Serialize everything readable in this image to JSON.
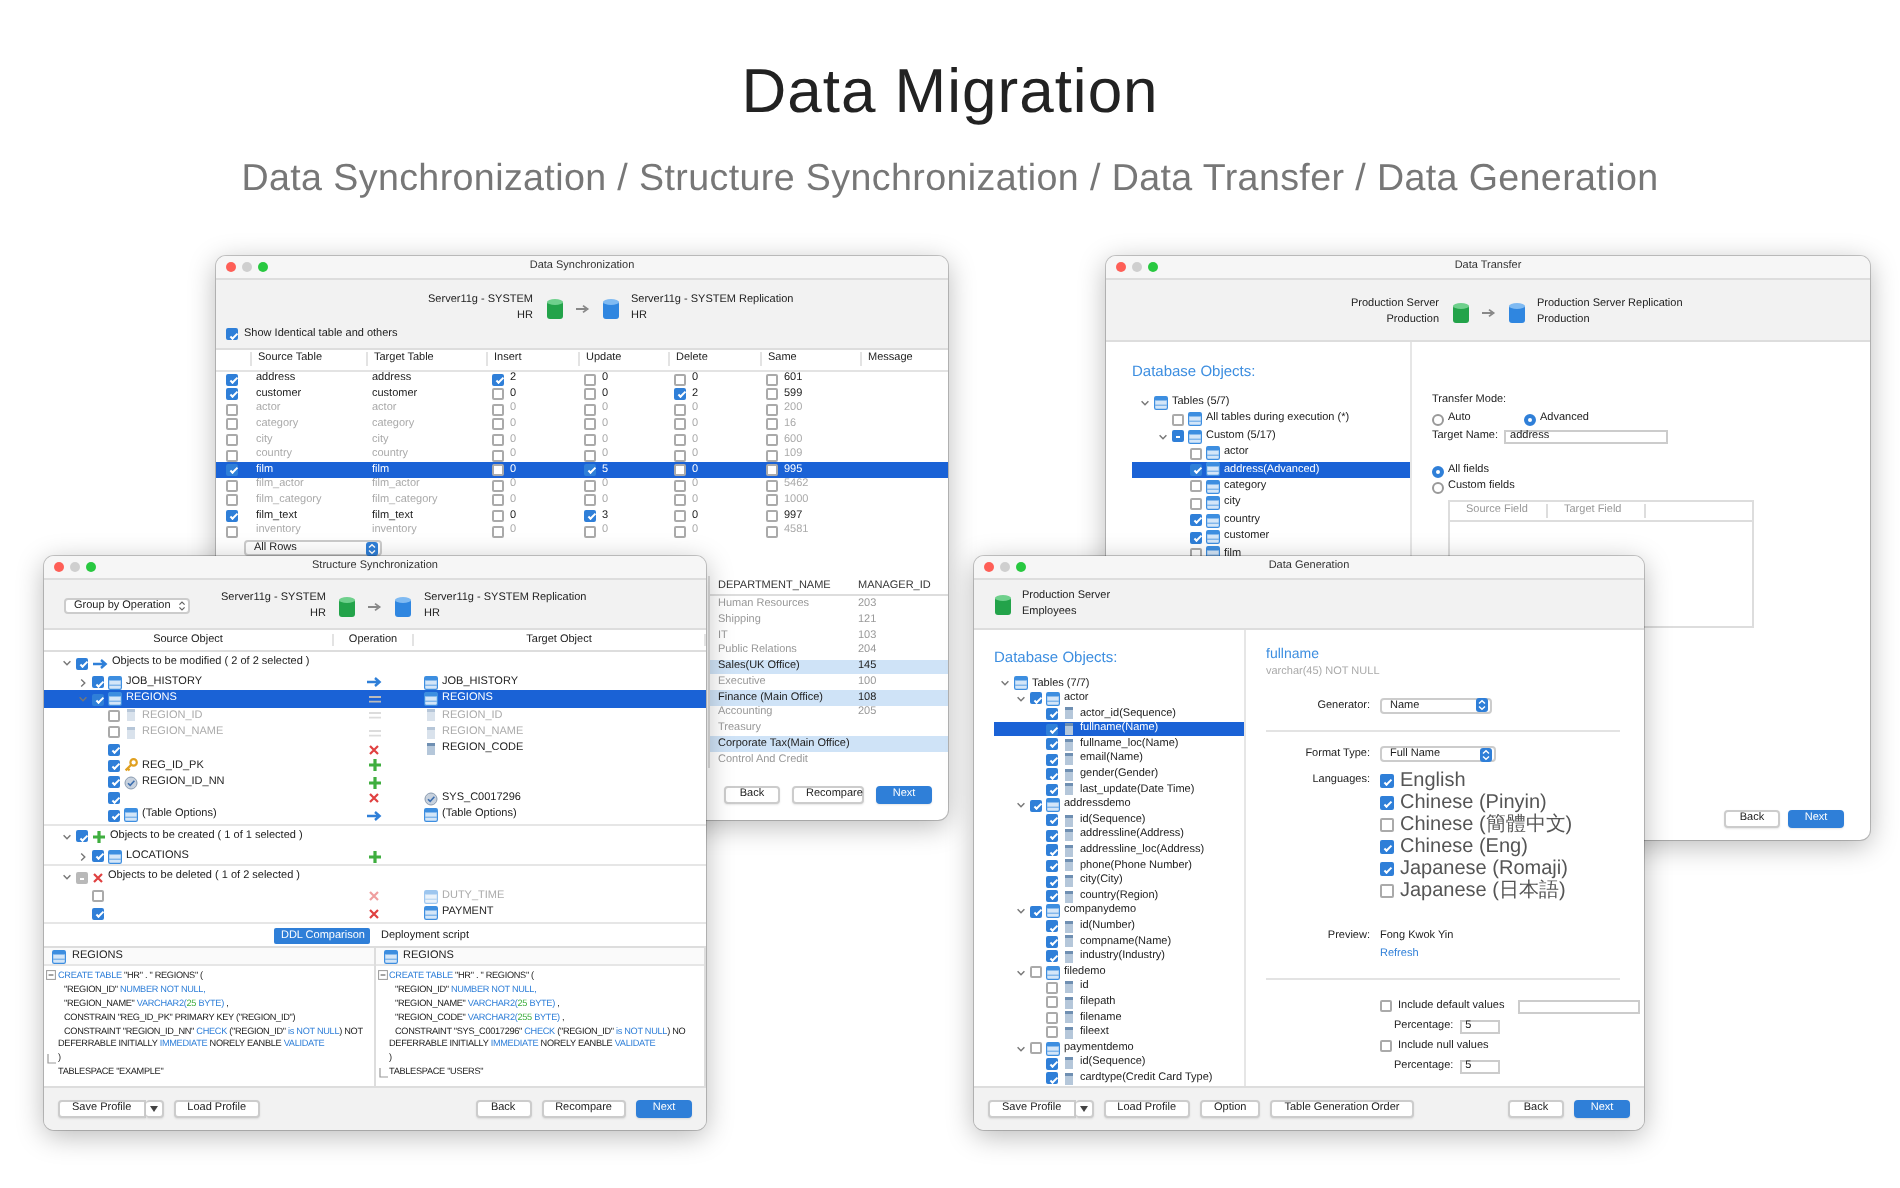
{
  "heading": {
    "title": "Data Migration",
    "subtitle": "Data Synchronization / Structure Synchronization / Data Transfer / Data Generation"
  },
  "data_sync": {
    "title": "Data Synchronization",
    "source": {
      "server": "Server11g - SYSTEM",
      "schema": "HR"
    },
    "target": {
      "server": "Server11g - SYSTEM Replication",
      "schema": "HR"
    },
    "show_identical": {
      "label": "Show Identical table and others",
      "checked": true
    },
    "columns": [
      "Source Table",
      "Target Table",
      "Insert",
      "Update",
      "Delete",
      "Same",
      "Message"
    ],
    "rows": [
      {
        "checked": true,
        "selected": false,
        "source": "address",
        "target": "address",
        "insert": {
          "checked": true,
          "value": "2"
        },
        "update": {
          "checked": false,
          "value": "0"
        },
        "delete": {
          "checked": false,
          "value": "0"
        },
        "same": {
          "checked": false,
          "value": "601"
        }
      },
      {
        "checked": true,
        "selected": false,
        "source": "customer",
        "target": "customer",
        "insert": {
          "checked": false,
          "value": "0"
        },
        "update": {
          "checked": false,
          "value": "0"
        },
        "delete": {
          "checked": true,
          "value": "2"
        },
        "same": {
          "checked": false,
          "value": "599"
        }
      },
      {
        "checked": false,
        "selected": false,
        "source": "actor",
        "target": "actor",
        "insert": {
          "checked": false,
          "value": "0"
        },
        "update": {
          "checked": false,
          "value": "0"
        },
        "delete": {
          "checked": false,
          "value": "0"
        },
        "same": {
          "checked": false,
          "value": "200"
        }
      },
      {
        "checked": false,
        "selected": false,
        "source": "category",
        "target": "category",
        "insert": {
          "checked": false,
          "value": "0"
        },
        "update": {
          "checked": false,
          "value": "0"
        },
        "delete": {
          "checked": false,
          "value": "0"
        },
        "same": {
          "checked": false,
          "value": "16"
        }
      },
      {
        "checked": false,
        "selected": false,
        "source": "city",
        "target": "city",
        "insert": {
          "checked": false,
          "value": "0"
        },
        "update": {
          "checked": false,
          "value": "0"
        },
        "delete": {
          "checked": false,
          "value": "0"
        },
        "same": {
          "checked": false,
          "value": "600"
        }
      },
      {
        "checked": false,
        "selected": false,
        "source": "country",
        "target": "country",
        "insert": {
          "checked": false,
          "value": "0"
        },
        "update": {
          "checked": false,
          "value": "0"
        },
        "delete": {
          "checked": false,
          "value": "0"
        },
        "same": {
          "checked": false,
          "value": "109"
        }
      },
      {
        "checked": true,
        "selected": true,
        "source": "film",
        "target": "film",
        "insert": {
          "checked": false,
          "value": "0"
        },
        "update": {
          "checked": true,
          "value": "5"
        },
        "delete": {
          "checked": false,
          "value": "0"
        },
        "same": {
          "checked": false,
          "value": "995"
        }
      },
      {
        "checked": false,
        "selected": false,
        "source": "film_actor",
        "target": "film_actor",
        "insert": {
          "checked": false,
          "value": "0"
        },
        "update": {
          "checked": false,
          "value": "0"
        },
        "delete": {
          "checked": false,
          "value": "0"
        },
        "same": {
          "checked": false,
          "value": "5462"
        }
      },
      {
        "checked": false,
        "selected": false,
        "source": "film_category",
        "target": "film_category",
        "insert": {
          "checked": false,
          "value": "0"
        },
        "update": {
          "checked": false,
          "value": "0"
        },
        "delete": {
          "checked": false,
          "value": "0"
        },
        "same": {
          "checked": false,
          "value": "1000"
        }
      },
      {
        "checked": true,
        "selected": false,
        "source": "film_text",
        "target": "film_text",
        "insert": {
          "checked": false,
          "value": "0"
        },
        "update": {
          "checked": true,
          "value": "3"
        },
        "delete": {
          "checked": false,
          "value": "0"
        },
        "same": {
          "checked": false,
          "value": "997"
        }
      },
      {
        "checked": false,
        "selected": false,
        "source": "inventory",
        "target": "inventory",
        "insert": {
          "checked": false,
          "value": "0"
        },
        "update": {
          "checked": false,
          "value": "0"
        },
        "delete": {
          "checked": false,
          "value": "0"
        },
        "same": {
          "checked": false,
          "value": "4581"
        }
      }
    ],
    "filter": "All Rows",
    "preview": {
      "columns": [
        "DEPARTMENT_NAME",
        "MANAGER_ID"
      ],
      "rows": [
        {
          "cells": [
            "Human Resources",
            "203"
          ],
          "selected": false
        },
        {
          "cells": [
            "Shipping",
            "121"
          ],
          "selected": false
        },
        {
          "cells": [
            "IT",
            "103"
          ],
          "selected": false
        },
        {
          "cells": [
            "Public Relations",
            "204"
          ],
          "selected": false
        },
        {
          "cells": [
            "Sales(UK Office)",
            "145"
          ],
          "selected": true
        },
        {
          "cells": [
            "Executive",
            "100"
          ],
          "selected": false
        },
        {
          "cells": [
            "Finance (Main Office)",
            "108"
          ],
          "selected": true
        },
        {
          "cells": [
            "Accounting",
            "205"
          ],
          "selected": false
        },
        {
          "cells": [
            "Treasury"
          ],
          "selected": false
        },
        {
          "cells": [
            "Corporate Tax(Main Office)"
          ],
          "selected": true
        },
        {
          "cells": [
            "Control And Credit"
          ],
          "selected": false
        }
      ]
    },
    "buttons": [
      {
        "label": "Back",
        "primary": false
      },
      {
        "label": "Recompare",
        "primary": false
      },
      {
        "label": "Next",
        "primary": true
      }
    ]
  },
  "data_transfer": {
    "title": "Data Transfer",
    "source": {
      "server": "Production Server",
      "schema": "Production"
    },
    "target": {
      "server": "Production Server Replication",
      "schema": "Production"
    },
    "objects_heading": "Database Objects:",
    "tree": [
      {
        "label": "Tables (5/7)",
        "kind": "table",
        "expanded": true,
        "selected": false,
        "children": [
          {
            "label": "All tables during execution (*)",
            "kind": "table",
            "checked": false,
            "partial": false,
            "selected": false
          },
          {
            "label": "Custom (5/17)",
            "kind": "table",
            "checked": true,
            "partial": true,
            "expanded": true,
            "selected": false,
            "children": [
              {
                "label": "actor",
                "kind": "table",
                "checked": false,
                "selected": false
              },
              {
                "label": "address(Advanced)",
                "kind": "table",
                "checked": true,
                "selected": true
              },
              {
                "label": "category",
                "kind": "table",
                "checked": false,
                "selected": false
              },
              {
                "label": "city",
                "kind": "table",
                "checked": false,
                "selected": false
              },
              {
                "label": "country",
                "kind": "table",
                "checked": true,
                "selected": false
              },
              {
                "label": "customer",
                "kind": "table",
                "checked": true,
                "selected": false
              },
              {
                "label": "film",
                "kind": "table",
                "checked": false,
                "selected": false
              }
            ]
          }
        ]
      }
    ],
    "transfer_mode": {
      "label": "Transfer Mode:",
      "options": [
        {
          "label": "Auto",
          "selected": false
        },
        {
          "label": "Advanced",
          "selected": true
        }
      ]
    },
    "target_name": {
      "label": "Target Name:",
      "value": "address"
    },
    "field_mode": [
      {
        "label": "All fields",
        "selected": true
      },
      {
        "label": "Custom fields",
        "selected": false
      }
    ],
    "field_columns": [
      "Source Field",
      "Target Field"
    ],
    "buttons": [
      {
        "label": "Back",
        "primary": false
      },
      {
        "label": "Next",
        "primary": true
      }
    ]
  },
  "structure_sync": {
    "title": "Structure Synchronization",
    "source": {
      "server": "Server11g - SYSTEM",
      "schema": "HR"
    },
    "target": {
      "server": "Server11g - SYSTEM Replication",
      "schema": "HR"
    },
    "group_by": "Group by Operation",
    "columns": [
      "Source Object",
      "Operation",
      "Target Object"
    ],
    "groups": [
      {
        "label": "Objects to be modified ( 2 of 2 selected )",
        "operation": {
          "kind": "modify"
        },
        "checked": true,
        "partial": false,
        "expanded": true,
        "children": [
          {
            "name": "JOB_HISTORY",
            "kind": "table",
            "checked": true,
            "selected": false,
            "operation": {
              "kind": "modify"
            },
            "expanded": false,
            "target": {
              "name": "JOB_HISTORY",
              "kind": "table"
            }
          },
          {
            "name": "REGIONS",
            "kind": "table",
            "checked": true,
            "selected": true,
            "operation": {
              "kind": "equal"
            },
            "expanded": true,
            "target": {
              "name": "REGIONS",
              "kind": "table"
            },
            "children": [
              {
                "name": "REGION_ID",
                "kind": "column",
                "checked": false,
                "selected": false,
                "operation": {
                  "kind": "equal"
                },
                "target": {
                  "name": "REGION_ID",
                  "kind": "column"
                }
              },
              {
                "name": "REGION_NAME",
                "kind": "column",
                "checked": false,
                "selected": false,
                "operation": {
                  "kind": "equal"
                },
                "target": {
                  "name": "REGION_NAME",
                  "kind": "column"
                }
              },
              {
                "checked": true,
                "selected": false,
                "operation": {
                  "kind": "delete"
                },
                "target": {
                  "name": "REGION_CODE",
                  "kind": "column"
                }
              },
              {
                "name": "REG_ID_PK",
                "kind": "key",
                "checked": true,
                "selected": false,
                "operation": {
                  "kind": "add"
                }
              },
              {
                "name": "REGION_ID_NN",
                "kind": "constraint",
                "checked": true,
                "selected": false,
                "operation": {
                  "kind": "add"
                }
              },
              {
                "checked": true,
                "selected": false,
                "operation": {
                  "kind": "delete"
                },
                "target": {
                  "name": "SYS_C0017296",
                  "kind": "constraint"
                }
              },
              {
                "name": "(Table Options)",
                "kind": "table",
                "checked": true,
                "selected": false,
                "operation": {
                  "kind": "modify"
                },
                "target": {
                  "name": "(Table Options)",
                  "kind": "table"
                }
              }
            ]
          }
        ]
      },
      {
        "label": "Objects to be created ( 1 of 1 selected )",
        "operation": {
          "kind": "add"
        },
        "checked": true,
        "partial": false,
        "expanded": true,
        "children": [
          {
            "name": "LOCATIONS",
            "kind": "table",
            "checked": true,
            "selected": false,
            "operation": {
              "kind": "add"
            },
            "expanded": false
          }
        ]
      },
      {
        "label": "Objects to be deleted ( 1 of 2 selected )",
        "operation": {
          "kind": "delete"
        },
        "checked": false,
        "partial": true,
        "expanded": true,
        "children": [
          {
            "checked": false,
            "selected": false,
            "operation": {
              "kind": "delete"
            },
            "target": {
              "name": "DUTY_TIME",
              "kind": "table"
            }
          },
          {
            "checked": true,
            "selected": false,
            "operation": {
              "kind": "delete"
            },
            "target": {
              "name": "PAYMENT",
              "kind": "table"
            }
          }
        ]
      }
    ],
    "tabs": [
      {
        "label": "DDL Comparison",
        "selected": true
      },
      {
        "label": "Deployment script",
        "selected": false
      }
    ],
    "ddl": [
      {
        "title": "REGIONS",
        "lines": [
          {
            "fold": {
              "kind": "start"
            },
            "indented": false,
            "parts": [
              {
                "kind": "keyword",
                "text": "CREATE TABLE"
              },
              {
                "kind": "plain",
                "text": " \"HR\" . \" REGIONS\" ("
              }
            ]
          },
          {
            "indented": true,
            "parts": [
              {
                "kind": "plain",
                "text": "\"REGION_ID\" "
              },
              {
                "kind": "keyword",
                "text": "NUMBER NOT NULL,"
              }
            ]
          },
          {
            "indented": true,
            "parts": [
              {
                "kind": "plain",
                "text": "\"REGION_NAME\" "
              },
              {
                "kind": "keyword",
                "text": "VARCHAR2("
              },
              {
                "kind": "number",
                "text": "25"
              },
              {
                "kind": "keyword",
                "text": " BYTE)"
              },
              {
                "kind": "plain",
                "text": " ,"
              }
            ]
          },
          {
            "indented": true,
            "parts": [
              {
                "kind": "plain",
                "text": "CONSTRAIN \"REG_ID_PK\" PRIMARY KEY (\"REGION_ID\")"
              }
            ]
          },
          {
            "indented": true,
            "parts": [
              {
                "kind": "plain",
                "text": "CONSTRAINT \"REGION_ID_NN\" "
              },
              {
                "kind": "keyword",
                "text": "CHECK"
              },
              {
                "kind": "plain",
                "text": " (\"REGION_ID\" "
              },
              {
                "kind": "keyword",
                "text": "is NOT NULL"
              },
              {
                "kind": "plain",
                "text": ") NOT"
              }
            ]
          },
          {
            "indented": false,
            "parts": [
              {
                "kind": "plain",
                "text": "DEFERRABLE INITIALLY "
              },
              {
                "kind": "keyword",
                "text": "IMMEDIATE"
              },
              {
                "kind": "plain",
                "text": " NORELY EANBLE "
              },
              {
                "kind": "keyword",
                "text": "VALIDATE"
              }
            ]
          },
          {
            "fold": {
              "kind": "end"
            },
            "indented": false,
            "parts": [
              {
                "kind": "plain",
                "text": ")"
              }
            ]
          },
          {
            "indented": false,
            "parts": [
              {
                "kind": "plain",
                "text": "TABLESPACE \"EXAMPLE\""
              }
            ]
          }
        ]
      },
      {
        "title": "REGIONS",
        "lines": [
          {
            "fold": {
              "kind": "start"
            },
            "indented": false,
            "parts": [
              {
                "kind": "keyword",
                "text": "CREATE TABLE"
              },
              {
                "kind": "plain",
                "text": " \"HR\" . \" REGIONS\" ("
              }
            ]
          },
          {
            "indented": true,
            "parts": [
              {
                "kind": "plain",
                "text": "\"REGION_ID\" "
              },
              {
                "kind": "keyword",
                "text": "NUMBER NOT NULL,"
              }
            ]
          },
          {
            "indented": true,
            "parts": [
              {
                "kind": "plain",
                "text": "\"REGION_NAME\" "
              },
              {
                "kind": "keyword",
                "text": "VARCHAR2("
              },
              {
                "kind": "number",
                "text": "25"
              },
              {
                "kind": "keyword",
                "text": " BYTE)"
              },
              {
                "kind": "plain",
                "text": " ,"
              }
            ]
          },
          {
            "indented": true,
            "parts": [
              {
                "kind": "plain",
                "text": "\"REGION_CODE\" "
              },
              {
                "kind": "keyword",
                "text": "VARCHAR2("
              },
              {
                "kind": "number",
                "text": "255"
              },
              {
                "kind": "keyword",
                "text": " BYTE)"
              },
              {
                "kind": "plain",
                "text": " ,"
              }
            ]
          },
          {
            "indented": true,
            "parts": [
              {
                "kind": "plain",
                "text": "CONSTRAINT \"SYS_C0017296\" "
              },
              {
                "kind": "keyword",
                "text": "CHECK"
              },
              {
                "kind": "plain",
                "text": " (\"REGION_ID\" "
              },
              {
                "kind": "keyword",
                "text": "is NOT NULL"
              },
              {
                "kind": "plain",
                "text": ") NO"
              }
            ]
          },
          {
            "indented": false,
            "parts": [
              {
                "kind": "plain",
                "text": "DEFERRABLE INITIALLY "
              },
              {
                "kind": "keyword",
                "text": "IMMEDIATE"
              },
              {
                "kind": "plain",
                "text": " NORELY EANBLE "
              },
              {
                "kind": "keyword",
                "text": "VALIDATE"
              }
            ]
          },
          {
            "indented": false,
            "parts": [
              {
                "kind": "plain",
                "text": ")"
              }
            ]
          },
          {
            "fold": {
              "kind": "end"
            },
            "indented": false,
            "parts": [
              {
                "kind": "plain",
                "text": "TABLESPACE \"USERS\""
              }
            ]
          }
        ]
      }
    ],
    "footer_left": [
      {
        "label": "Save Profile",
        "menu": true
      },
      {
        "label": "Load Profile",
        "menu": false
      }
    ],
    "buttons": [
      {
        "label": "Back",
        "primary": false
      },
      {
        "label": "Recompare",
        "primary": false
      },
      {
        "label": "Next",
        "primary": true
      }
    ]
  },
  "data_generation": {
    "title": "Data Generation",
    "server": {
      "server": "Production Server",
      "schema": "Employees"
    },
    "objects_heading": "Database Objects:",
    "tree": [
      {
        "label": "Tables (7/7)",
        "kind": "table",
        "expanded": true,
        "selected": false,
        "children": [
          {
            "label": "actor",
            "kind": "table",
            "checked": true,
            "expanded": true,
            "selected": false,
            "children": [
              {
                "label": "actor_id(Sequence)",
                "kind": "column",
                "checked": true,
                "selected": false
              },
              {
                "label": "fullname(Name)",
                "kind": "column",
                "checked": true,
                "selected": true
              },
              {
                "label": "fullname_loc(Name)",
                "kind": "column",
                "checked": true,
                "selected": false
              },
              {
                "label": "email(Name)",
                "kind": "column",
                "checked": true,
                "selected": false
              },
              {
                "label": "gender(Gender)",
                "kind": "column",
                "checked": true,
                "selected": false
              },
              {
                "label": "last_update(Date Time)",
                "kind": "column",
                "checked": true,
                "selected": false
              }
            ]
          },
          {
            "label": "addressdemo",
            "kind": "table",
            "checked": true,
            "expanded": true,
            "selected": false,
            "children": [
              {
                "label": "id(Sequence)",
                "kind": "column",
                "checked": true,
                "selected": false
              },
              {
                "label": "addressline(Address)",
                "kind": "column",
                "checked": true,
                "selected": false
              },
              {
                "label": "addressline_loc(Address)",
                "kind": "column",
                "checked": true,
                "selected": false
              },
              {
                "label": "phone(Phone Number)",
                "kind": "column",
                "checked": true,
                "selected": false
              },
              {
                "label": "city(City)",
                "kind": "column",
                "checked": true,
                "selected": false
              },
              {
                "label": "country(Region)",
                "kind": "column",
                "checked": true,
                "selected": false
              }
            ]
          },
          {
            "label": "companydemo",
            "kind": "table",
            "checked": true,
            "expanded": true,
            "selected": false,
            "children": [
              {
                "label": "id(Number)",
                "kind": "column",
                "checked": true,
                "selected": false
              },
              {
                "label": "compname(Name)",
                "kind": "column",
                "checked": true,
                "selected": false
              },
              {
                "label": "industry(Industry)",
                "kind": "column",
                "checked": true,
                "selected": false
              }
            ]
          },
          {
            "label": "filedemo",
            "kind": "table",
            "checked": false,
            "expanded": true,
            "selected": false,
            "children": [
              {
                "label": "id",
                "kind": "column",
                "checked": false,
                "selected": false
              },
              {
                "label": "filepath",
                "kind": "column",
                "checked": false,
                "selected": false
              },
              {
                "label": "filename",
                "kind": "column",
                "checked": false,
                "selected": false
              },
              {
                "label": "fileext",
                "kind": "column",
                "checked": false,
                "selected": false
              }
            ]
          },
          {
            "label": "paymentdemo",
            "kind": "table",
            "checked": false,
            "expanded": true,
            "selected": false,
            "children": [
              {
                "label": "id(Sequence)",
                "kind": "column",
                "checked": true,
                "selected": false
              },
              {
                "label": "cardtype(Credit Card Type)",
                "kind": "column",
                "checked": true,
                "selected": false
              }
            ]
          }
        ]
      }
    ],
    "field": {
      "name": "fullname",
      "type": "varchar(45) NOT NULL"
    },
    "generator": {
      "label": "Generator:",
      "value": "Name"
    },
    "format_type": {
      "label": "Format Type:",
      "value": "Full Name"
    },
    "languages": {
      "label": "Languages:",
      "options": [
        {
          "label": "English",
          "checked": true
        },
        {
          "label": "Chinese (Pinyin)",
          "checked": true
        },
        {
          "label": "Chinese (簡體中文)",
          "checked": false
        },
        {
          "label": "Chinese (Eng)",
          "checked": true
        },
        {
          "label": "Japanese (Romaji)",
          "checked": true
        },
        {
          "label": "Japanese (日本語)",
          "checked": false
        }
      ]
    },
    "preview": {
      "label": "Preview:",
      "value": "Fong Kwok Yin",
      "action": "Refresh"
    },
    "options": [
      {
        "kind": "include_field",
        "label": "Include default values",
        "checked": false
      },
      {
        "kind": "percentage",
        "label": "Percentage:",
        "value": "5"
      },
      {
        "kind": "include",
        "label": "Include null values",
        "checked": false
      },
      {
        "kind": "percentage",
        "label": "Percentage:",
        "value": "5"
      }
    ],
    "footer_left": [
      {
        "label": "Save Profile",
        "menu": true
      },
      {
        "label": "Load Profile",
        "menu": false
      },
      {
        "label": "Option",
        "menu": false
      },
      {
        "label": "Table Generation Order",
        "menu": false
      }
    ],
    "buttons": [
      {
        "label": "Back",
        "primary": false
      },
      {
        "label": "Next",
        "primary": true
      }
    ]
  }
}
